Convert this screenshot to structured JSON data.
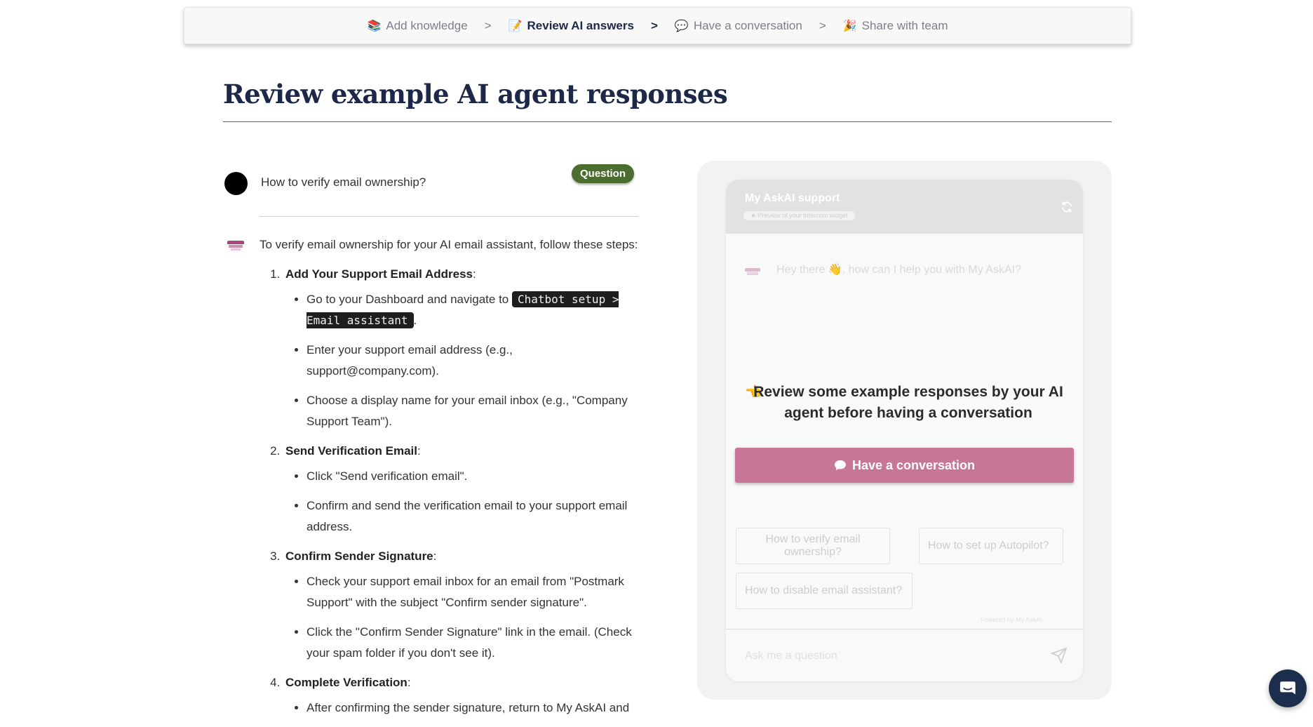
{
  "stepper": {
    "steps": [
      {
        "label": "Add knowledge",
        "icon": "books-icon",
        "glyph": "📚"
      },
      {
        "label": "Review AI answers",
        "icon": "memo-icon",
        "glyph": "📝"
      },
      {
        "label": "Have a conversation",
        "icon": "speech-bubble-icon",
        "glyph": "💬"
      },
      {
        "label": "Share with team",
        "icon": "party-popper-icon",
        "glyph": "🎉"
      }
    ],
    "separator": ">",
    "active_index": 1
  },
  "page": {
    "title": "Review example AI agent responses"
  },
  "question": {
    "text": "How to verify email ownership?",
    "badge": "Question"
  },
  "answer": {
    "intro": "To verify email ownership for your AI email assistant, follow these steps:",
    "steps": [
      {
        "heading": "Add Your Support Email Address",
        "items": [
          {
            "pre": "Go to your Dashboard and navigate to ",
            "code": "Chatbot setup > Email assistant",
            "post": "."
          },
          {
            "text": "Enter your support email address (e.g., support@company.com)."
          },
          {
            "text": "Choose a display name for your email inbox (e.g., \"Company Support Team\")."
          }
        ]
      },
      {
        "heading": "Send Verification Email",
        "items": [
          {
            "text": "Click \"Send verification email\"."
          },
          {
            "text": "Confirm and send the verification email to your support email address."
          }
        ]
      },
      {
        "heading": "Confirm Sender Signature",
        "items": [
          {
            "text": "Check your support email inbox for an email from \"Postmark Support\" with the subject \"Confirm sender signature\"."
          },
          {
            "text": "Click the \"Confirm Sender Signature\" link in the email. (Check your spam folder if you don't see it)."
          }
        ]
      },
      {
        "heading": "Complete Verification",
        "items": [
          {
            "text": "After confirming the sender signature, return to My AskAI and"
          }
        ]
      }
    ]
  },
  "widget": {
    "title": "My AskAI support",
    "tag": "★ Preview of your Intercom widget",
    "greeting": "Hey there 👋, how can I help you with My AskAI?",
    "overlay_message": "Review some example responses by your AI agent before having a conversation",
    "overlay_icon": "👈",
    "cta_label": "Have a conversation",
    "suggestions": [
      "How to verify email ownership?",
      "How to set up Autopilot?",
      "How to disable email assistant?"
    ],
    "powered_by": "Powered by My AskAI",
    "input_placeholder": "Ask me a question"
  },
  "colors": {
    "brand_navy": "#1d2748",
    "badge_green": "#4b6d2f",
    "cta_pink": "#c87698",
    "logo_magenta": "#a9467a"
  }
}
